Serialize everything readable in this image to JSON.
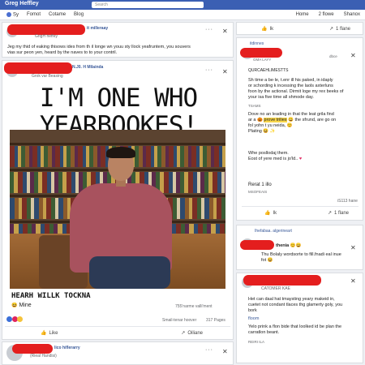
{
  "topbar": {
    "brand": "Greg Heffley",
    "search_placeholder": "Search"
  },
  "nav": {
    "left": [
      "Sy",
      "Fomot",
      "Cotame",
      "Blog"
    ],
    "right": [
      "Home",
      "2 flowe",
      "Shanox"
    ]
  },
  "post1": {
    "author_suffix": "it milleraay",
    "subtitle": "GrigH heffey",
    "body": "Jeg my thid of eaking thisows ides from th il longe wn youu sty llock yeafruntem, you souvers\nvias sur peon yen, heard by the naves to to your contril."
  },
  "post2": {
    "author_suffix": "N.J0. H Milainda",
    "subtitle": "Grok var Beasing",
    "meme_title": "I'M ONE WHO YEARBOOKES!",
    "caption": "HEARH WILLK TOCKNA",
    "reaction_label": "Mine",
    "reaction_meta": "755'narme valli'ment",
    "stats_left": "Smail-tenar hoover",
    "stats_right": "317 Pages",
    "like_label": "Like",
    "share_label": "Oiliane"
  },
  "post3": {
    "author_suffix": "lico hiflerarry",
    "subtitle": "(Rieal Handisi)"
  },
  "right_top": {
    "like_label": "Ik",
    "share_label": "1 flane"
  },
  "right_post1": {
    "header": "itdinnes",
    "author_line": "GMA LAYY",
    "time": "dbce",
    "subtitle": "QURCAEHLIMESTTS",
    "line1": "Sh time a be·le, t.enr ill his paked, in idaply",
    "line2": "or schording k incessing the laols axterluns",
    "line3": "foon by the actional. Dirmit loge my rex beeks of",
    "line4": "your isa five time all shmode day.",
    "tag": "TSAMS",
    "line5": "Dove no an leading in that the leat grila find",
    "line6": "ar a",
    "line6b": "prove trilies",
    "line6c": "the sfrund, are go on",
    "line7": "fol yohn t yu neida,",
    "line8": "Plating",
    "line9": "Whe posllodaj them.",
    "line10": "Eost of yere med is jo'ld..",
    "footer_left": "Rerat 1 illo",
    "footer_sub": "MSOFEAIS",
    "footer_right": "iS113 hane",
    "like_label": "Ik",
    "share_label": "1 flane"
  },
  "right_post2": {
    "header": "Ihefabaa. algerineart",
    "author": "thenia",
    "line1": "Thu Bolaly wordsorte to fill.fnadi eal inue",
    "line2": "fot"
  },
  "right_post3": {
    "subtitle": "CATOMER KAE",
    "line1": "Het can daal hat tmaysting yeary makeid in,",
    "line2": "cuetet not condant tlaces thg glamerty goly, you",
    "line3": "bork",
    "tag": "floom",
    "line4": "Yelo prink a flon bide that loolked id be plan the",
    "line5": "carratlon beant.",
    "footer": "REIRI ILA"
  },
  "colors": {
    "topbar": "#3b5fb3",
    "redact": "#e41e1e",
    "like": "#3b6fd8",
    "heart": "#e0245e"
  }
}
